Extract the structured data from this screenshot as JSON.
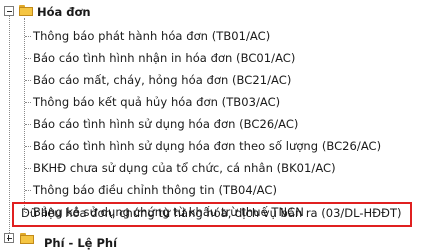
{
  "tree": {
    "section": {
      "label": "Hóa đơn",
      "expanded": true
    },
    "items": [
      {
        "label": "Thông báo phát hành hóa đơn (TB01/AC)"
      },
      {
        "label": "Báo cáo tình hình nhận in hóa đơn (BC01/AC)"
      },
      {
        "label": "Báo cáo mất, cháy, hỏng hóa đơn (BC21/AC)"
      },
      {
        "label": "Thông báo kết quả hủy hóa đơn (TB03/AC)"
      },
      {
        "label": "Báo cáo tình hình sử dụng hóa đơn (BC26/AC)"
      },
      {
        "label": "Báo cáo tình hình sử dụng hóa đơn theo số lượng (BC26/AC)"
      },
      {
        "label": "BKHĐ chưa sử dụng của tổ chức, cá nhân (BK01/AC)"
      },
      {
        "label": "Thông báo điều chỉnh thông tin (TB04/AC)"
      },
      {
        "label": "Bảng kê sử dụng chứng từ khấu trừ thuế TNCN"
      }
    ],
    "selected_item": {
      "label": "Dữ liệu hóa đơn, chứng từ hàng hóa, dịch vụ bán ra (03/DL-HĐĐT)"
    },
    "next_section": {
      "label": "Phí - Lệ Phí",
      "expanded": false
    }
  },
  "colors": {
    "selection_border": "#e02020",
    "folder": "#f5c542"
  }
}
